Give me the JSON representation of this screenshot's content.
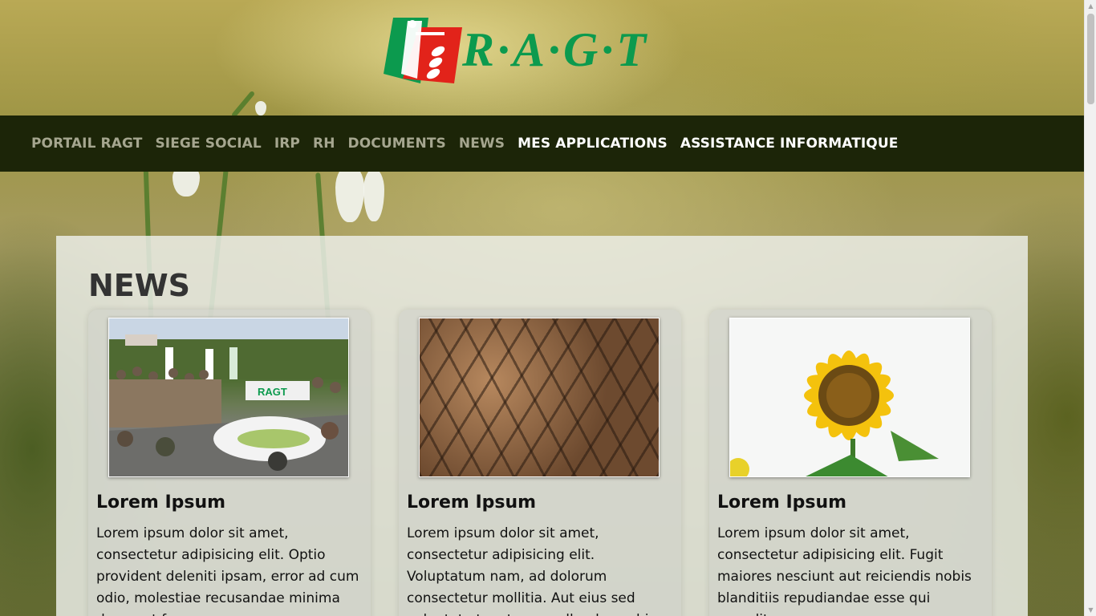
{
  "brand": {
    "logo_text": "R·A·G·T",
    "colors": {
      "green": "#0c9a4e",
      "red": "#e2231a",
      "nav_bg": "#1c2508"
    }
  },
  "nav": {
    "items": [
      {
        "label": "PORTAIL RAGT"
      },
      {
        "label": "SIEGE SOCIAL"
      },
      {
        "label": "IRP"
      },
      {
        "label": "RH"
      },
      {
        "label": "DOCUMENTS"
      },
      {
        "label": "NEWS"
      },
      {
        "label": "MES APPLICATIONS"
      },
      {
        "label": "ASSISTANCE INFORMATIQUE"
      }
    ]
  },
  "news": {
    "title": "NEWS",
    "cards": [
      {
        "image": "crowd-parade-car-image",
        "title": "Lorem Ipsum",
        "text": "Lorem ipsum dolor sit amet, consectetur adipisicing elit. Optio provident deleniti ipsam, error ad cum odio, molestiae recusandae minima deserunt facere"
      },
      {
        "image": "firewood-stack-image",
        "title": "Lorem Ipsum",
        "text": "Lorem ipsum dolor sit amet, consectetur adipisicing elit. Voluptatum nam, ad dolorum consectetur mollitia. Aut eius sed voluptate tenetur, repellendus nobis"
      },
      {
        "image": "sunflower-image",
        "title": "Lorem Ipsum",
        "text": "Lorem ipsum dolor sit amet, consectetur adipisicing elit. Fugit maiores nesciunt aut reiciendis nobis blanditiis repudiandae esse qui expedita"
      }
    ]
  }
}
